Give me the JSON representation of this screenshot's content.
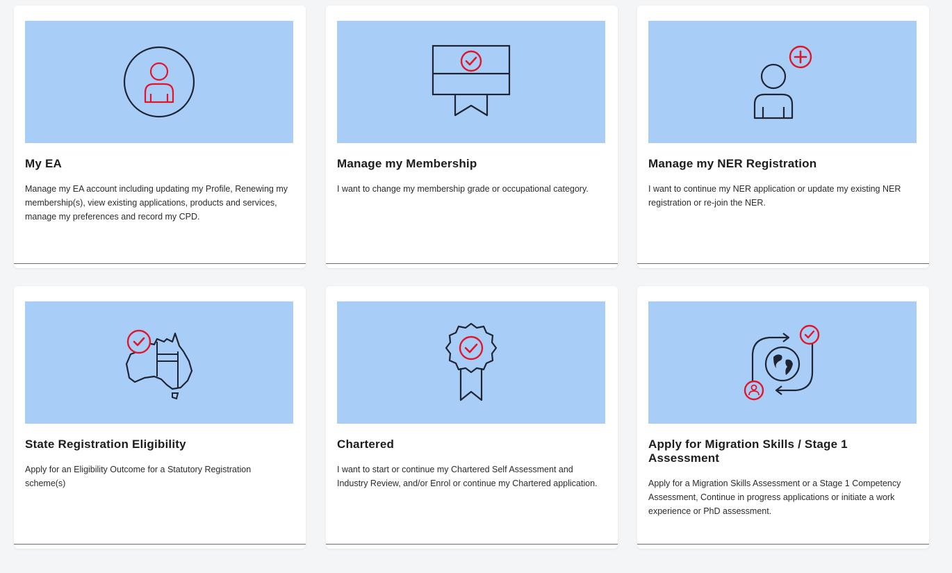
{
  "cards": [
    {
      "title": "My EA",
      "description": "Manage my EA account including updating my Profile, Renewing my membership(s), view existing applications, products and services, manage my preferences and record my CPD.",
      "icon": "user-profile-icon"
    },
    {
      "title": "Manage my Membership",
      "description": "I want to change my membership grade or occupational category.",
      "icon": "membership-certificate-icon"
    },
    {
      "title": "Manage my NER Registration",
      "description": "I want to continue my NER application or update my existing NER registration or re-join the NER.",
      "icon": "add-user-icon"
    },
    {
      "title": "State Registration Eligibility",
      "description": "Apply for an Eligibility Outcome for a Statutory Registration scheme(s)",
      "icon": "australia-map-check-icon"
    },
    {
      "title": "Chartered",
      "description": "I want to start or continue my Chartered Self Assessment and Industry Review, and/or Enrol or continue my Chartered application.",
      "icon": "award-rosette-icon"
    },
    {
      "title": "Apply for Migration Skills / Stage 1 Assessment",
      "description": "Apply for a Migration Skills Assessment or a Stage 1 Competency Assessment, Continue in progress applications or initiate a work experience or PhD assessment.",
      "icon": "globe-migration-icon"
    }
  ],
  "colors": {
    "card_image_bg": "#a8cdf6",
    "icon_dark": "#1f2433",
    "icon_accent": "#e0162b"
  }
}
